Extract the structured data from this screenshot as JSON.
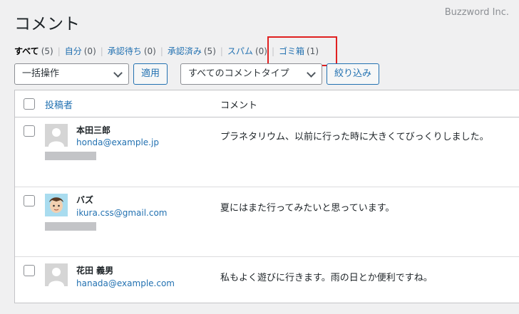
{
  "page": {
    "title": "コメント",
    "watermark": "Buzzword Inc."
  },
  "filters": [
    {
      "label": "すべて",
      "count": "(5)",
      "current": true
    },
    {
      "label": "自分",
      "count": "(0)"
    },
    {
      "label": "承認待ち",
      "count": "(0)"
    },
    {
      "label": "承認済み",
      "count": "(5)"
    },
    {
      "label": "スパム",
      "count": "(0)"
    },
    {
      "label": "ゴミ箱",
      "count": "(1)"
    }
  ],
  "separator": "|",
  "toolbar": {
    "bulk_action": "一括操作",
    "apply": "適用",
    "comment_type": "すべてのコメントタイプ",
    "filter": "絞り込み"
  },
  "table": {
    "columns": [
      "投稿者",
      "コメント"
    ],
    "rows": [
      {
        "name": "本田三郎",
        "email": "honda@example.jp",
        "comment": "プラネタリウム、以前に行った時に大きくてびっくりしました。",
        "avatar": "mystery-person-icon"
      },
      {
        "name": "バズ",
        "email": "ikura.css@gmail.com",
        "comment": "夏にはまた行ってみたいと思っています。",
        "avatar": "cartoon-face-icon"
      },
      {
        "name": "花田 義男",
        "email": "hanada@example.com",
        "comment": "私もよく遊びに行きます。雨の日とか便利ですね。",
        "avatar": "mystery-person-icon"
      }
    ]
  },
  "colors": {
    "link": "#2271b1",
    "highlight_box": "#e02020"
  }
}
